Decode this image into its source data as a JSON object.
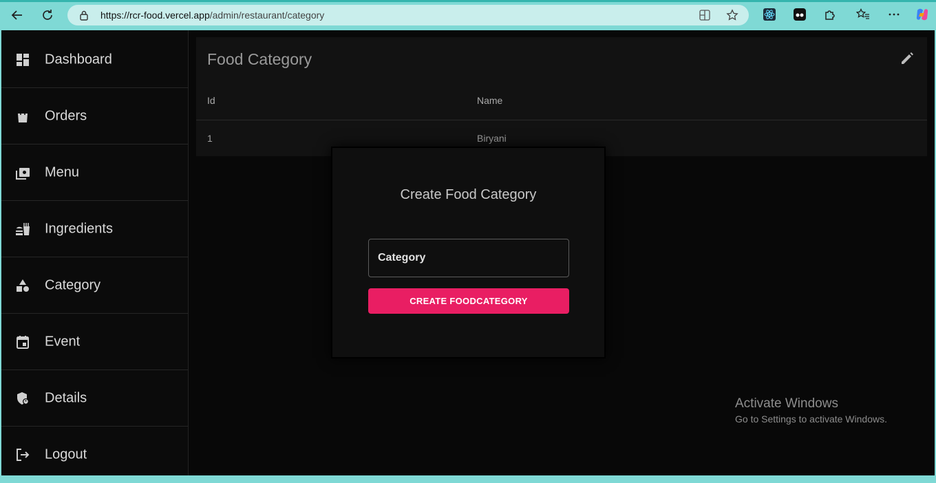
{
  "browser": {
    "url_host": "https://rcr-food.vercel.app",
    "url_path": "/admin/restaurant/category"
  },
  "sidebar": {
    "items": [
      {
        "label": "Dashboard",
        "icon": "dashboard-icon"
      },
      {
        "label": "Orders",
        "icon": "shopping-bag-icon"
      },
      {
        "label": "Menu",
        "icon": "menu-book-icon"
      },
      {
        "label": "Ingredients",
        "icon": "fastfood-icon"
      },
      {
        "label": "Category",
        "icon": "category-icon"
      },
      {
        "label": "Event",
        "icon": "event-icon"
      },
      {
        "label": "Details",
        "icon": "admin-panel-icon"
      },
      {
        "label": "Logout",
        "icon": "logout-icon"
      }
    ]
  },
  "card": {
    "title": "Food Category",
    "columns": [
      "Id",
      "Name"
    ],
    "rows": [
      [
        "1",
        "Biryani"
      ]
    ]
  },
  "modal": {
    "title": "Create Food Category",
    "input_placeholder": "Category",
    "input_value": "",
    "button_label": "CREATE FOODCATEGORY"
  },
  "watermark": {
    "line1": "Activate Windows",
    "line2": "Go to Settings to activate Windows."
  },
  "colors": {
    "accent": "#e91e63",
    "background": "#080808",
    "card": "#121212",
    "chrome": "#7fd9d5"
  }
}
